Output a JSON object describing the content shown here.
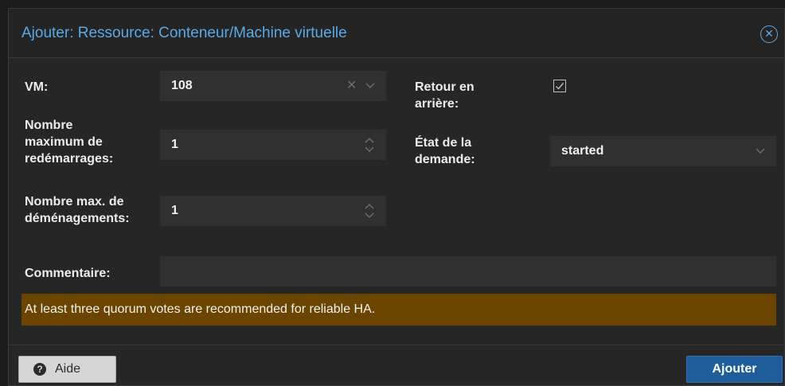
{
  "dialog": {
    "title": "Ajouter: Ressource: Conteneur/Machine virtuelle"
  },
  "form": {
    "vm": {
      "label": "VM:",
      "value": "108"
    },
    "max_restart": {
      "label_lines": [
        "Nombre",
        "maximum de",
        "redémarrages:"
      ],
      "value": "1"
    },
    "max_relocate": {
      "label_lines": [
        "Nombre max. de",
        "déménagements:"
      ],
      "value": "1"
    },
    "failback": {
      "label_lines": [
        "Retour en",
        "arrière:"
      ],
      "checked": "true"
    },
    "state": {
      "label_lines": [
        "État de la",
        "demande:"
      ],
      "value": "started"
    },
    "comment": {
      "label": "Commentaire:",
      "value": ""
    }
  },
  "warning": {
    "text": "At least three quorum votes are recommended for reliable HA."
  },
  "footer": {
    "help_label": "Aide",
    "submit_label": "Ajouter"
  },
  "colors": {
    "accent": "#5aa9e6",
    "warning_bg": "#6b4500",
    "primary_button": "#1f5d9a"
  },
  "icons": {
    "close": "circle-x-icon",
    "clear": "x-icon",
    "dropdown": "chevron-down-icon",
    "spinner": "spinner-arrows-icon",
    "help": "question-circle-icon",
    "checkbox": "checkmark-icon"
  }
}
